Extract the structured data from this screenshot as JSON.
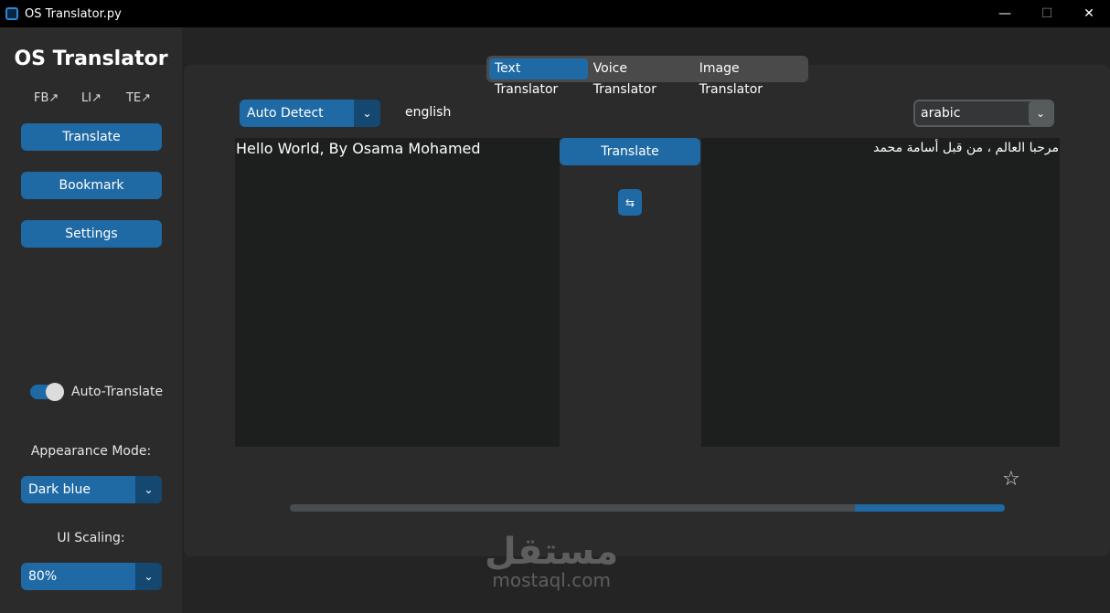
{
  "window": {
    "title": "OS Translator.py",
    "minimize": "—",
    "maximize": "☐",
    "close": "✕"
  },
  "sidebar": {
    "logo": "OS Translator",
    "links": [
      "FB↗",
      "LI↗",
      "TE↗"
    ],
    "buttons": [
      "Translate",
      "Bookmark",
      "Settings"
    ],
    "auto_translate": {
      "label": "Auto-Translate",
      "on": true
    },
    "appearance_label": "Appearance Mode:",
    "appearance_value": "Dark blue",
    "scaling_label": "UI Scaling:",
    "scaling_value": "80%"
  },
  "tabs": [
    {
      "label": "Text Translator",
      "active": true
    },
    {
      "label": "Voice Translator",
      "active": false
    },
    {
      "label": "Image Translator",
      "active": false
    }
  ],
  "translator": {
    "source_language": "Auto Detect",
    "detected_language": "english",
    "target_language": "arabic",
    "source_text": "Hello World, By Osama Mohamed",
    "target_text": "مرحبا العالم ، من قبل أسامة محمد",
    "translate_label": "Translate",
    "swap_icon": "⇆",
    "bookmark_icon": "☆",
    "progress": 0.21
  },
  "watermark": {
    "arabic": "مستقل",
    "latin": "mostaql.com"
  },
  "colors": {
    "accent": "#1f6aa5",
    "accent_dark": "#144870",
    "background": "#242424",
    "panel": "#2b2b2b",
    "textbox": "#1d1e1e"
  }
}
